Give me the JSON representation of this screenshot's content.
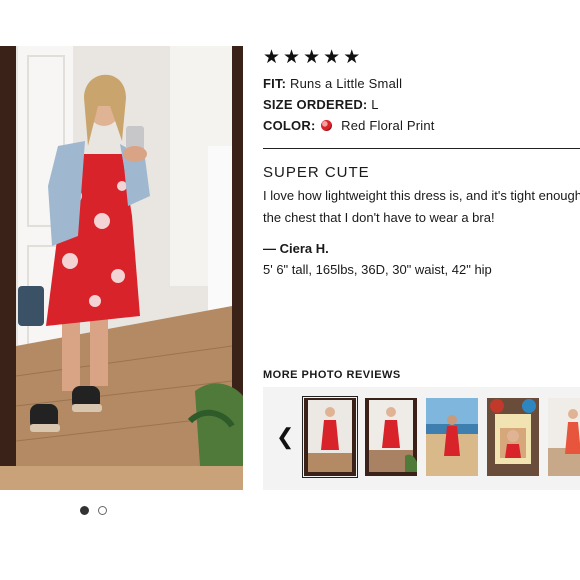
{
  "review": {
    "stars": [
      "★",
      "★",
      "★",
      "★",
      "★"
    ],
    "fit_label": "FIT:",
    "fit_value": "Runs a Little Small",
    "size_label": "SIZE ORDERED:",
    "size_value": "L",
    "color_label": "COLOR:",
    "color_value": "Red Floral Print",
    "title": "SUPER CUTE",
    "body_line1": "I love how lightweight this dress is, and it's tight enough in",
    "body_line2": "the chest that I don't have to wear a bra!",
    "author": "— Ciera H.",
    "stats": "5' 6\" tall, 165lbs, 36D, 30\" waist, 42\" hip"
  },
  "more_photos": {
    "heading": "MORE PHOTO REVIEWS",
    "prev_icon": "chevron-left-icon",
    "thumbs": [
      "thumb-1",
      "thumb-2",
      "thumb-3",
      "thumb-4",
      "thumb-5"
    ]
  },
  "carousel": {
    "count": 2,
    "active": 1
  },
  "colors": {
    "dress_red": "#d8232a",
    "text": "#1a1a1a",
    "strip_bg": "#f3f3f3"
  }
}
